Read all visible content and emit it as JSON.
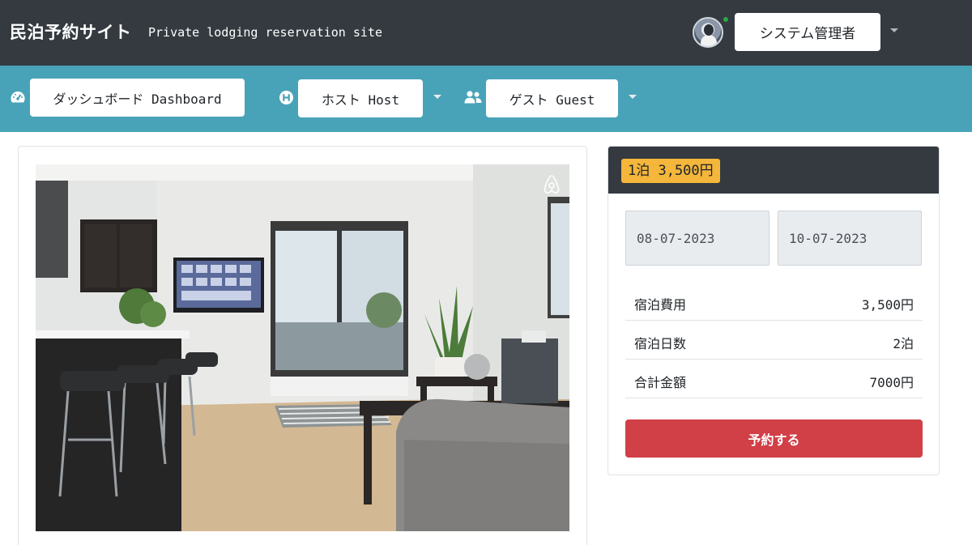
{
  "header": {
    "title": "民泊予約サイト",
    "subtitle": "Private lodging reservation site",
    "user_button_label": "システム管理者",
    "user_status_color": "#28a745"
  },
  "nav": {
    "dashboard": {
      "label": "ダッシュボード Dashboard",
      "icon": "tachometer-icon"
    },
    "host": {
      "label": "ホスト Host",
      "icon": "hotel-h-icon"
    },
    "guest": {
      "label": "ゲスト Guest",
      "icon": "users-icon"
    }
  },
  "listing": {
    "photo_description": "bright living room with kitchen bar stools, TV, window and sofa",
    "watermark_icon": "airbnb-logo-icon"
  },
  "booking": {
    "price_badge": "1泊 3,500円",
    "checkin_date": "08-07-2023",
    "checkout_date": "10-07-2023",
    "rows": [
      {
        "label": "宿泊費用",
        "value": "3,500円"
      },
      {
        "label": "宿泊日数",
        "value": "2泊"
      },
      {
        "label": "合計金額",
        "value": "7000円"
      }
    ],
    "reserve_label": "予約する"
  },
  "colors": {
    "topbar": "#343a40",
    "navbar": "#49a3b8",
    "badge": "#f4b63b",
    "reserve": "#d13f47"
  }
}
